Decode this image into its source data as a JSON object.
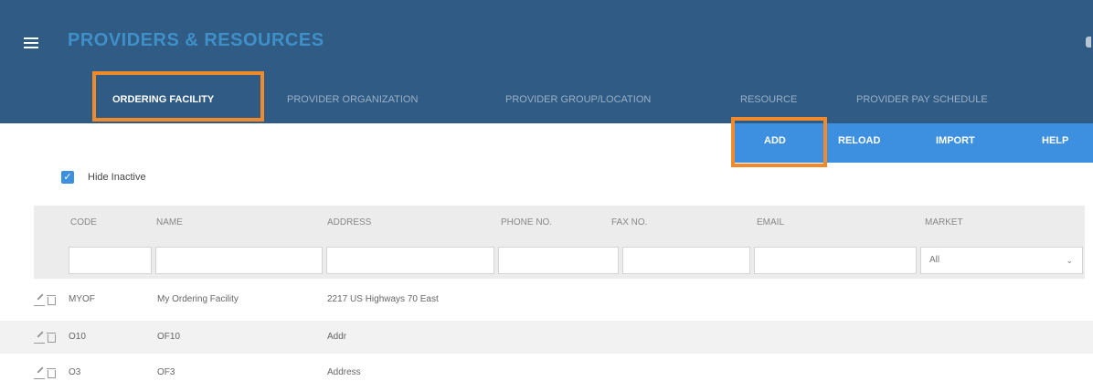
{
  "header": {
    "title": "PROVIDERS & RESOURCES",
    "tabs": [
      {
        "label": "ORDERING FACILITY",
        "active": true
      },
      {
        "label": "PROVIDER ORGANIZATION",
        "active": false
      },
      {
        "label": "PROVIDER GROUP/LOCATION",
        "active": false
      },
      {
        "label": "RESOURCE",
        "active": false
      },
      {
        "label": "PROVIDER PAY SCHEDULE",
        "active": false
      }
    ]
  },
  "toolbar": {
    "add_label": "ADD",
    "reload_label": "RELOAD",
    "import_label": "IMPORT",
    "help_label": "HELP"
  },
  "filter_options": {
    "hide_inactive_label": "Hide Inactive",
    "hide_inactive_checked": true
  },
  "grid": {
    "columns": [
      "CODE",
      "NAME",
      "ADDRESS",
      "PHONE NO.",
      "FAX NO.",
      "EMAIL",
      "MARKET"
    ],
    "market_filter_value": "All",
    "rows": [
      {
        "code": "MYOF",
        "name": "My Ordering Facility",
        "address": "2217 US Highways 70 East"
      },
      {
        "code": "O10",
        "name": "OF10",
        "address": "Addr"
      },
      {
        "code": "O3",
        "name": "OF3",
        "address": "Address"
      }
    ]
  },
  "colors": {
    "header_bg": "#2f5b84",
    "toolbar_bg": "#3d8fe0",
    "highlight": "#f08a2a"
  }
}
